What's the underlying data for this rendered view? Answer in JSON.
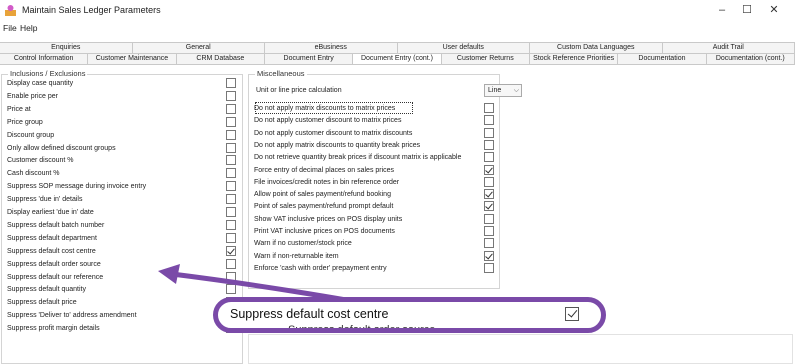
{
  "window": {
    "title": "Maintain Sales Ledger Parameters",
    "minimize": "–",
    "maximize": "☐",
    "close": "✕"
  },
  "menu": [
    "File",
    "Help"
  ],
  "tabs_top": [
    {
      "label": "Enquiries",
      "active": false
    },
    {
      "label": "General",
      "active": false
    },
    {
      "label": "eBusiness",
      "active": false
    },
    {
      "label": "User defaults",
      "active": false
    },
    {
      "label": "Custom Data Languages",
      "active": false
    },
    {
      "label": "Audit Trail",
      "active": false
    }
  ],
  "tabs_bottom": [
    {
      "label": "Control Information",
      "active": false
    },
    {
      "label": "Customer Maintenance",
      "active": false
    },
    {
      "label": "CRM Database",
      "active": false
    },
    {
      "label": "Document Entry",
      "active": false
    },
    {
      "label": "Document Entry (cont.)",
      "active": true
    },
    {
      "label": "Customer Returns",
      "active": false
    },
    {
      "label": "Stock Reference Priorities",
      "active": false
    },
    {
      "label": "Documentation",
      "active": false
    },
    {
      "label": "Documentation (cont.)",
      "active": false
    }
  ],
  "inclusions": {
    "caption": "Inclusions / Exclusions",
    "items": [
      {
        "label": "Display case quantity",
        "checked": false
      },
      {
        "label": "Enable price per",
        "checked": false
      },
      {
        "label": "Price at",
        "checked": false
      },
      {
        "label": "Price group",
        "checked": false
      },
      {
        "label": "Discount group",
        "checked": false
      },
      {
        "label": "Only allow defined discount groups",
        "checked": false
      },
      {
        "label": "Customer discount %",
        "checked": false
      },
      {
        "label": "Cash discount %",
        "checked": false
      },
      {
        "label": "Suppress SOP message during invoice entry",
        "checked": false
      },
      {
        "label": "Suppress 'due in' details",
        "checked": false
      },
      {
        "label": "Display earliest 'due in' date",
        "checked": false
      },
      {
        "label": "Suppress default batch number",
        "checked": false
      },
      {
        "label": "Suppress default department",
        "checked": false
      },
      {
        "label": "Suppress default cost centre",
        "checked": true
      },
      {
        "label": "Suppress default order source",
        "checked": false
      },
      {
        "label": "Suppress default our reference",
        "checked": false
      },
      {
        "label": "Suppress default quantity",
        "checked": false
      },
      {
        "label": "Suppress default price",
        "checked": false
      },
      {
        "label": "Suppress 'Deliver to' address amendment",
        "checked": false
      },
      {
        "label": "Suppress profit margin details",
        "checked": false
      }
    ]
  },
  "misc": {
    "caption": "Miscellaneous",
    "unit_label": "Unit or line price calculation",
    "unit_value": "Line",
    "items": [
      {
        "label": "Do not apply matrix discounts to matrix prices",
        "checked": false
      },
      {
        "label": "Do not apply customer discount to matrix prices",
        "checked": false
      },
      {
        "label": "Do not apply customer discount to matrix discounts",
        "checked": false
      },
      {
        "label": "Do not apply matrix discounts to quantity break prices",
        "checked": false
      },
      {
        "label": "Do not retrieve quantity break prices if discount matrix is applicable",
        "checked": false
      },
      {
        "label": "Force entry of decimal places on sales prices",
        "checked": true
      },
      {
        "label": "File invoices/credit notes in bin reference order",
        "checked": false
      },
      {
        "label": "Allow point of sales payment/refund booking",
        "checked": true
      },
      {
        "label": "Point of sales payment/refund prompt default",
        "checked": true
      },
      {
        "label": "Show VAT inclusive prices on POS display units",
        "checked": false
      },
      {
        "label": "Print VAT inclusive prices on POS documents",
        "checked": false
      },
      {
        "label": "Warn if no customer/stock price",
        "checked": false
      },
      {
        "label": "Warn if non-returnable item",
        "checked": true
      },
      {
        "label": "Enforce 'cash with order' prepayment entry",
        "checked": false
      }
    ]
  },
  "callout": {
    "label": "Suppress default cost centre",
    "checked": true,
    "ghost_text": "Suppress default order source"
  },
  "colors": {
    "callout_border": "#7a4aa8",
    "arrow": "#7a4aa8"
  }
}
